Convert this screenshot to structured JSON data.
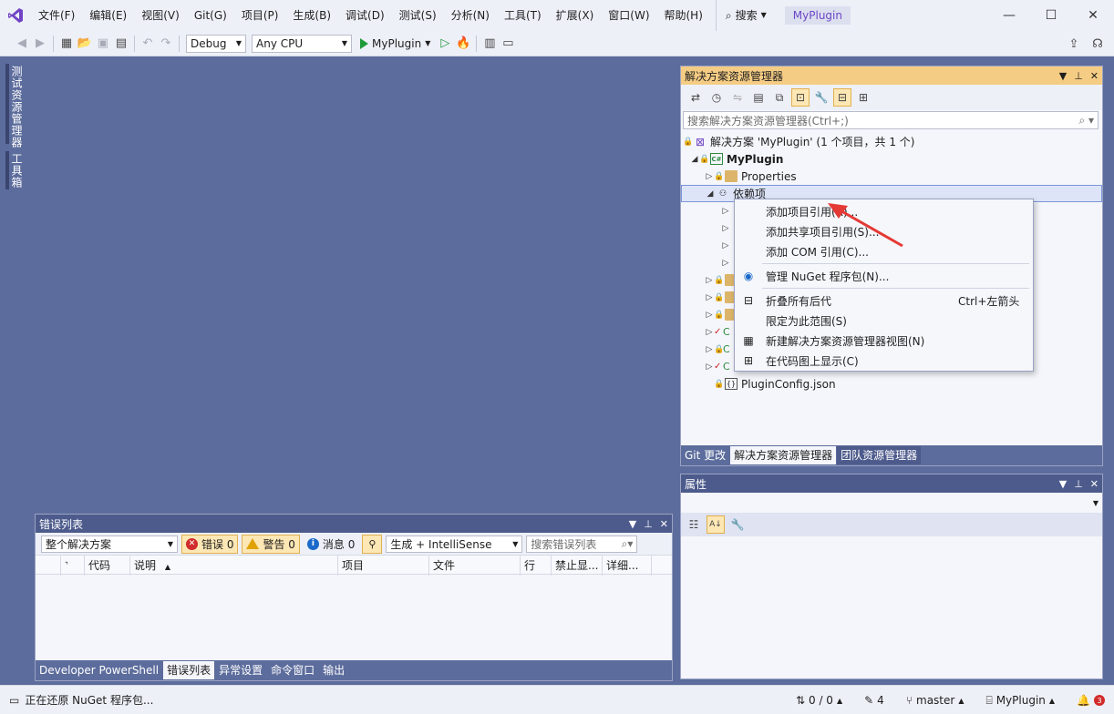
{
  "menu": {
    "items": [
      "文件(F)",
      "编辑(E)",
      "视图(V)",
      "Git(G)",
      "项目(P)",
      "生成(B)",
      "调试(D)",
      "测试(S)",
      "分析(N)",
      "工具(T)",
      "扩展(X)",
      "窗口(W)",
      "帮助(H)"
    ],
    "search_label": "搜索",
    "title_badge": "MyPlugin"
  },
  "toolbar": {
    "config": "Debug",
    "platform": "Any CPU",
    "run_target": "MyPlugin"
  },
  "left_tabs": {
    "tab1": "测试资源管理器",
    "tab2": "工具箱"
  },
  "solution_explorer": {
    "title": "解决方案资源管理器",
    "search_placeholder": "搜索解决方案资源管理器(Ctrl+;)",
    "tree": {
      "solution": "解决方案 'MyPlugin' (1 个项目，共 1 个)",
      "project": "MyPlugin",
      "properties": "Properties",
      "dependencies": "依赖项",
      "config_file": "PluginConfig.json",
      "c_prefix": "C"
    },
    "tabs": [
      "Git 更改",
      "解决方案资源管理器",
      "团队资源管理器"
    ]
  },
  "context_menu": {
    "items": [
      {
        "label": "添加项目引用(R)..."
      },
      {
        "label": "添加共享项目引用(S)..."
      },
      {
        "label": "添加 COM 引用(C)..."
      },
      {
        "label": "管理 NuGet 程序包(N)..."
      },
      {
        "label": "折叠所有后代",
        "shortcut": "Ctrl+左箭头"
      },
      {
        "label": "限定为此范围(S)"
      },
      {
        "label": "新建解决方案资源管理器视图(N)"
      },
      {
        "label": "在代码图上显示(C)"
      }
    ]
  },
  "properties": {
    "title": "属性"
  },
  "error_list": {
    "title": "错误列表",
    "scope": "整个解决方案",
    "errors_label": "错误 0",
    "warnings_label": "警告 0",
    "messages_label": "消息 0",
    "build_filter": "生成 + IntelliSense",
    "search_placeholder": "搜索错误列表",
    "columns": [
      "代码",
      "说明",
      "项目",
      "文件",
      "行",
      "禁止显...",
      "详细..."
    ]
  },
  "bottom_tabs": [
    "Developer PowerShell",
    "错误列表",
    "异常设置",
    "命令窗口",
    "输出"
  ],
  "statusbar": {
    "message": "正在还原 NuGet 程序包...",
    "sync": "0 / 0",
    "edits": "4",
    "branch": "master",
    "repo": "MyPlugin",
    "notifications": "3"
  },
  "colors": {
    "accent_purple": "#7044c4",
    "active_header": "#f5cc84",
    "shell_blue": "#5c6c9c",
    "arrow_red": "#e53935"
  }
}
